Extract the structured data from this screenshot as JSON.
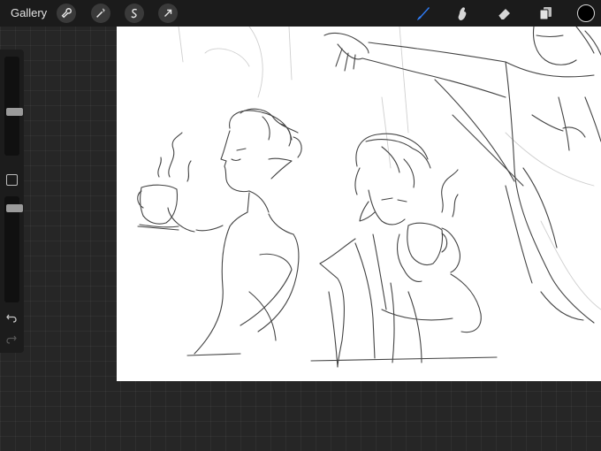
{
  "topbar": {
    "gallery_label": "Gallery",
    "left_tools": [
      "wrench-icon",
      "magic-wand-icon",
      "selection-icon",
      "transform-arrow-icon"
    ],
    "right_tools": [
      "brush-icon",
      "smudge-icon",
      "eraser-icon",
      "layers-icon"
    ],
    "active_tool": "brush-icon",
    "current_color": "#000000"
  },
  "sidebar": {
    "brush_size_level": 0.45,
    "opacity_level": 0.93,
    "buttons": [
      "modify-button",
      "undo-button",
      "redo-button"
    ]
  },
  "colors": {
    "accent": "#2f7cf6",
    "background": "#262626",
    "canvas": "#ffffff"
  }
}
